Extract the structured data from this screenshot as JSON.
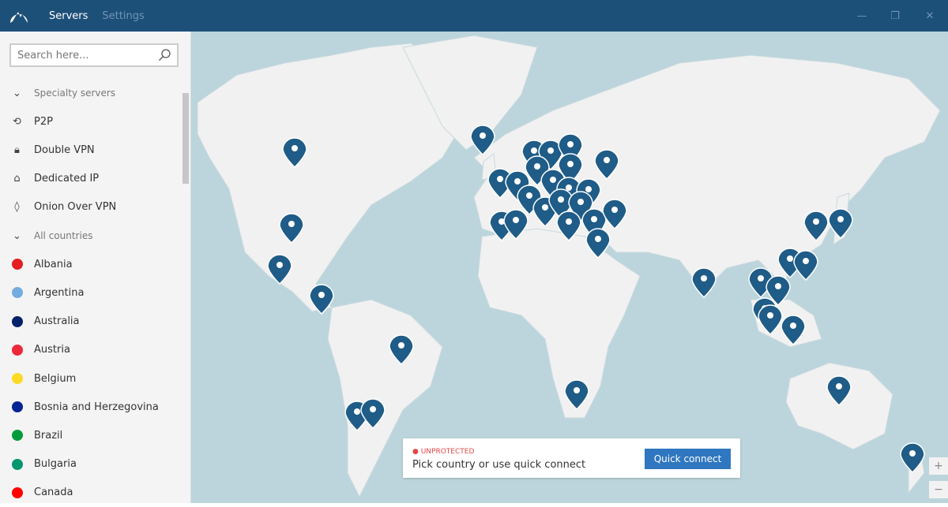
{
  "titlebar": {
    "tabs": [
      "Servers",
      "Settings"
    ],
    "active_tab": "Servers",
    "controls": [
      "minimize-icon",
      "restore-icon",
      "close-icon"
    ]
  },
  "search": {
    "placeholder": "Search here...",
    "value": ""
  },
  "sidebar": {
    "specialty_header": "Specialty servers",
    "specialty": [
      {
        "label": "P2P",
        "icon": "p2p-icon"
      },
      {
        "label": "Double VPN",
        "icon": "lock-icon"
      },
      {
        "label": "Dedicated IP",
        "icon": "home-icon"
      },
      {
        "label": "Onion Over VPN",
        "icon": "onion-icon"
      }
    ],
    "countries_header": "All countries",
    "countries": [
      {
        "label": "Albania",
        "flag": "#e41e20"
      },
      {
        "label": "Argentina",
        "flag": "#74acdf"
      },
      {
        "label": "Australia",
        "flag": "#012169"
      },
      {
        "label": "Austria",
        "flag": "#ed2939"
      },
      {
        "label": "Belgium",
        "flag": "#fdda24"
      },
      {
        "label": "Bosnia and Herzegovina",
        "flag": "#002395"
      },
      {
        "label": "Brazil",
        "flag": "#009c3b"
      },
      {
        "label": "Bulgaria",
        "flag": "#00966e"
      },
      {
        "label": "Canada",
        "flag": "#ff0000"
      }
    ]
  },
  "status": {
    "state": "UNPROTECTED",
    "message": "Pick country or use quick connect",
    "button": "Quick connect",
    "state_color": "#e04848"
  },
  "map": {
    "zoom_in": "+",
    "zoom_out": "−",
    "ocean_color": "#bcd5dc",
    "land_color": "#f1f1f1",
    "pin_color": "#1f5c87"
  }
}
